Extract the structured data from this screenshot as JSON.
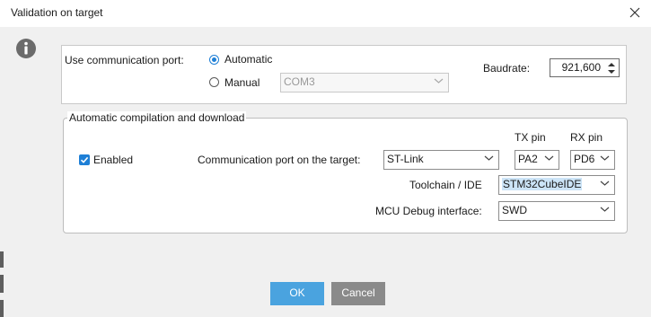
{
  "window": {
    "title": "Validation on target"
  },
  "comm_port": {
    "label": "Use communication port:",
    "automatic_label": "Automatic",
    "manual_label": "Manual",
    "selected": "Automatic",
    "manual_port_value": "COM3",
    "baudrate_label": "Baudrate:",
    "baudrate_value": "921,600"
  },
  "compilation": {
    "legend": "Automatic compilation and download",
    "enabled_label": "Enabled",
    "enabled_checked": true,
    "tx_header": "TX pin",
    "rx_header": "RX pin",
    "comm_port_target_label": "Communication port on the target:",
    "comm_port_target_value": "ST-Link",
    "tx_value": "PA2",
    "rx_value": "PD6",
    "toolchain_label": "Toolchain / IDE",
    "toolchain_value": "STM32CubeIDE",
    "mcu_debug_label": "MCU Debug interface:",
    "mcu_debug_value": "SWD"
  },
  "buttons": {
    "ok_label": "OK",
    "cancel_label": "Cancel"
  },
  "colors": {
    "accent": "#1e7fd6",
    "ok_button": "#4aa3df",
    "cancel_button": "#8a8a8a",
    "dialog_background": "#f0f0f0"
  },
  "icons": [
    "info-icon",
    "close-icon",
    "chevron-down-icon",
    "spin-up-down-icon",
    "checkmark-icon"
  ]
}
